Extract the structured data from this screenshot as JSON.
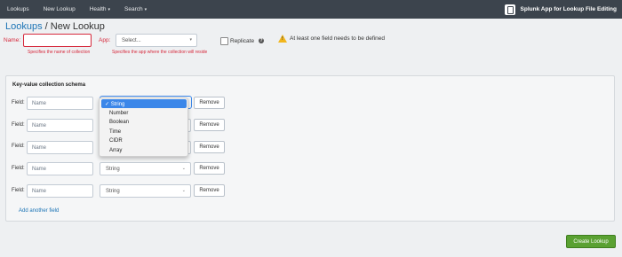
{
  "nav": {
    "items": [
      "Lookups",
      "New Lookup",
      "Health",
      "Search"
    ],
    "app_title": "Splunk App for Lookup File Editing"
  },
  "breadcrumb": {
    "parent": "Lookups",
    "separator": " / ",
    "current": "New Lookup"
  },
  "form": {
    "name_label": "Name:",
    "name_value": "",
    "name_hint": "Specifies the name of collection",
    "app_label": "App:",
    "app_value": "Select...",
    "app_hint": "Specifies the app where the collection will reside",
    "replicate_label": "Replicate",
    "help_glyph": "?",
    "warning": "At least one field needs to be defined"
  },
  "schema": {
    "title": "Key-value collection schema",
    "field_label": "Field:",
    "name_placeholder": "Name",
    "type_value": "String",
    "remove_label": "Remove",
    "add_link": "Add another field"
  },
  "type_options": [
    "✓ String",
    "Number",
    "Boolean",
    "Time",
    "CIDR",
    "Array"
  ],
  "create_label": "Create Lookup",
  "icons": {
    "caret": "caret-down-icon",
    "warning": "warning-icon",
    "app": "app-logo-icon"
  }
}
